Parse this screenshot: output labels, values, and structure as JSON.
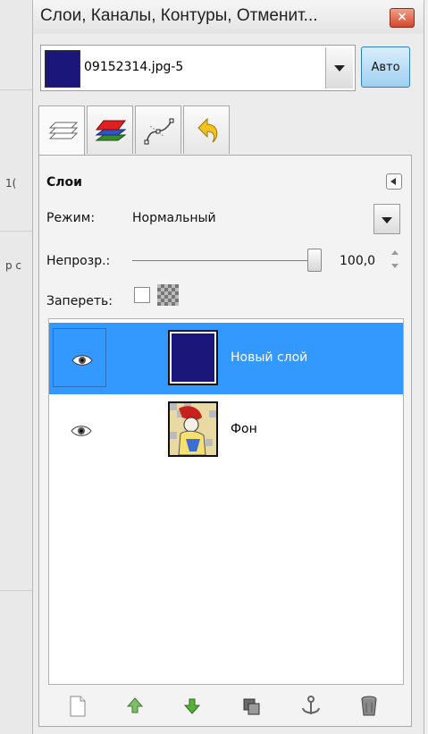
{
  "window": {
    "title": "Слои, Каналы, Контуры, Отменит...",
    "close_label": "×"
  },
  "left_strip": {
    "text1": "1(",
    "text2": "р с"
  },
  "image_selector": {
    "name": "09152314.jpg-5",
    "auto_label": "Авто",
    "swatch_color": "#1b1679"
  },
  "tabs": [
    {
      "icon": "layers-tab-icon",
      "active": true
    },
    {
      "icon": "channels-tab-icon",
      "active": false
    },
    {
      "icon": "paths-tab-icon",
      "active": false
    },
    {
      "icon": "undo-history-tab-icon",
      "active": false
    }
  ],
  "panel": {
    "title": "Слои",
    "mode_label": "Режим:",
    "mode_value": "Нормальный",
    "opacity_label": "Непрозр.:",
    "opacity_value": "100,0",
    "opacity_fraction": 1.0,
    "lock_label": "Запереть:"
  },
  "layers": [
    {
      "name": "Новый слой",
      "visible": true,
      "selected": true
    },
    {
      "name": "Фон",
      "visible": true,
      "selected": false
    }
  ],
  "toolbar": {
    "icons": [
      "new-layer-icon",
      "raise-layer-icon",
      "lower-layer-icon",
      "duplicate-layer-icon",
      "anchor-layer-icon",
      "delete-layer-icon"
    ]
  },
  "colors": {
    "selection": "#3399ff",
    "layer_fill": "#1b1679"
  }
}
